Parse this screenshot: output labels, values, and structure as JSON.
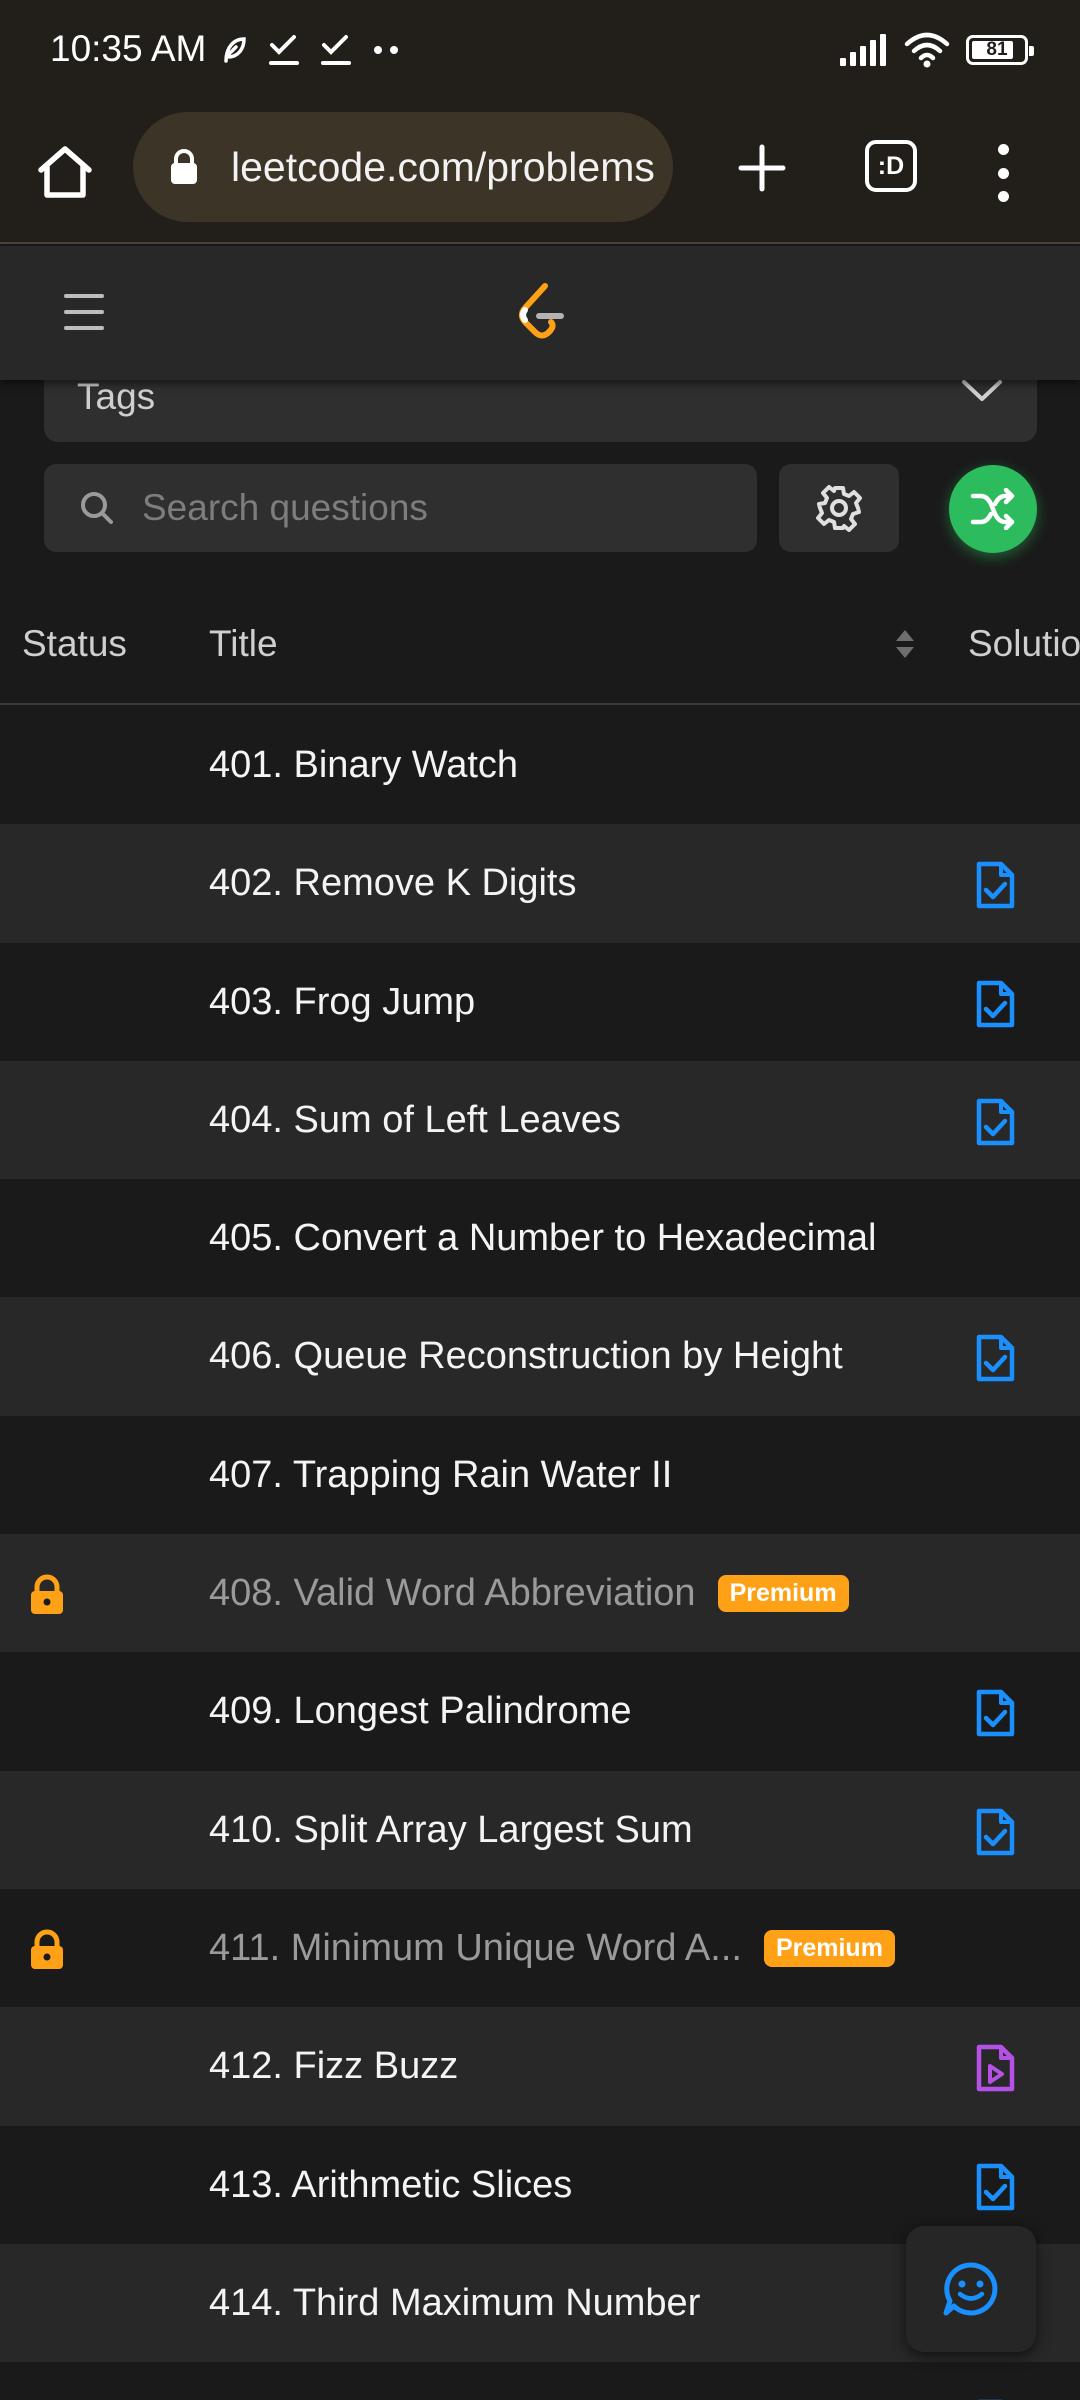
{
  "status_bar": {
    "time": "10:35 AM",
    "battery": "81"
  },
  "browser": {
    "url": "leetcode.com/problems",
    "tabs_label": ":D"
  },
  "filters": {
    "tags_label": "Tags",
    "search_placeholder": "Search questions"
  },
  "table": {
    "headers": {
      "status": "Status",
      "title": "Title",
      "solution": "Solution"
    },
    "rows": [
      {
        "title": "401. Binary Watch",
        "locked": false,
        "badge": "",
        "solution": "none"
      },
      {
        "title": "402. Remove K Digits",
        "locked": false,
        "badge": "",
        "solution": "article"
      },
      {
        "title": "403. Frog Jump",
        "locked": false,
        "badge": "",
        "solution": "article"
      },
      {
        "title": "404. Sum of Left Leaves",
        "locked": false,
        "badge": "",
        "solution": "article"
      },
      {
        "title": "405. Convert a Number to Hexadecimal",
        "locked": false,
        "badge": "",
        "solution": "none"
      },
      {
        "title": "406. Queue Reconstruction by Height",
        "locked": false,
        "badge": "",
        "solution": "article"
      },
      {
        "title": "407. Trapping Rain Water II",
        "locked": false,
        "badge": "",
        "solution": "none"
      },
      {
        "title": "408. Valid Word Abbreviation",
        "locked": true,
        "badge": "Premium",
        "solution": "none"
      },
      {
        "title": "409. Longest Palindrome",
        "locked": false,
        "badge": "",
        "solution": "article"
      },
      {
        "title": "410. Split Array Largest Sum",
        "locked": false,
        "badge": "",
        "solution": "article"
      },
      {
        "title": "411. Minimum Unique Word A...",
        "locked": true,
        "badge": "Premium",
        "solution": "none"
      },
      {
        "title": "412. Fizz Buzz",
        "locked": false,
        "badge": "",
        "solution": "video"
      },
      {
        "title": "413. Arithmetic Slices",
        "locked": false,
        "badge": "",
        "solution": "article"
      },
      {
        "title": "414. Third Maximum Number",
        "locked": false,
        "badge": "",
        "solution": "none"
      },
      {
        "title": "",
        "locked": false,
        "badge": "",
        "solution": "article"
      }
    ]
  },
  "colors": {
    "accent_green": "#2cbb5d",
    "premium_orange": "#ffa116",
    "solution_blue": "#1a90ff",
    "video_purple": "#b551e6"
  },
  "icons": {
    "home": "home-icon",
    "lock": "lock-icon",
    "plus": "plus-icon",
    "menu": "hamburger-icon",
    "logo": "leetcode-logo",
    "chevron": "chevron-down-icon",
    "search": "search-icon",
    "settings": "gear-icon",
    "shuffle": "shuffle-icon",
    "sort": "sort-icon",
    "solution_article": "solution-article-icon",
    "solution_video": "solution-video-icon",
    "chat": "chat-smiley-icon"
  }
}
